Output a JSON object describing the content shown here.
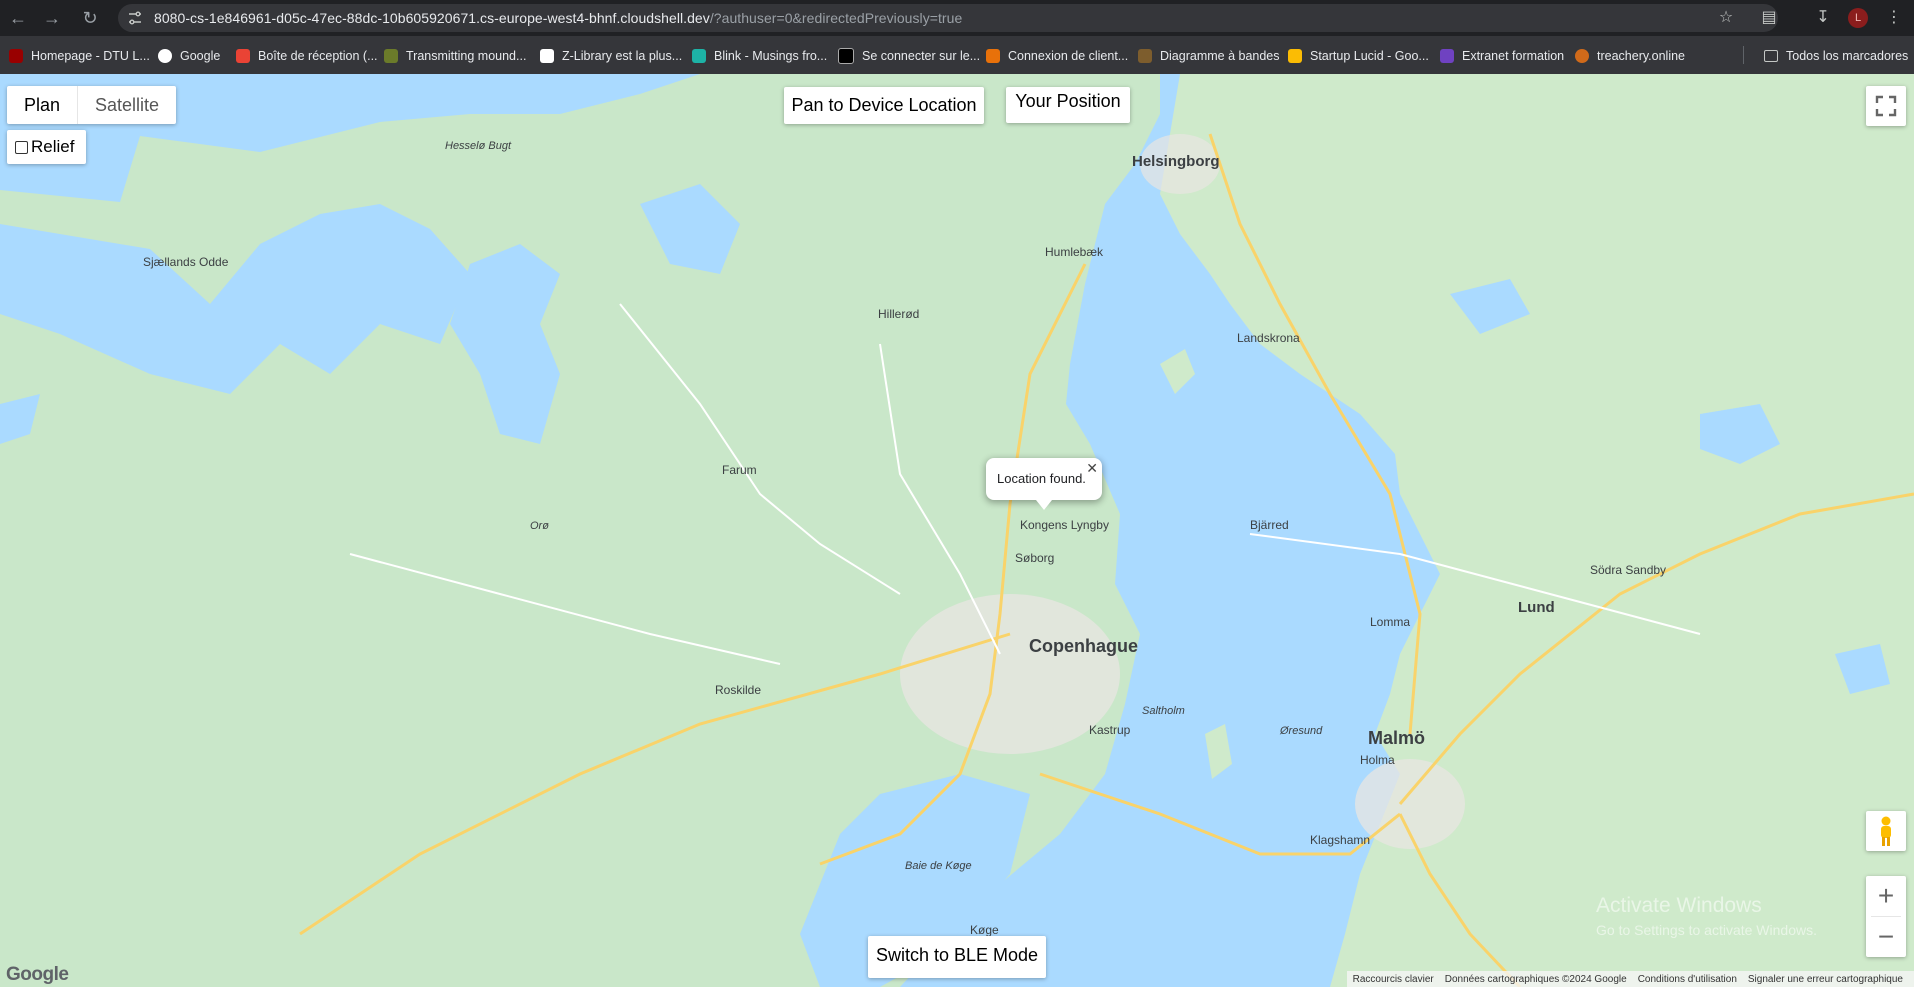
{
  "browser": {
    "url_main": "8080-cs-1e846961-d05c-47ec-88dc-10b605920671.cs-europe-west4-bhnf.cloudshell.dev",
    "url_query": "/?authuser=0&redirectedPreviously=true",
    "profile_initial": "L"
  },
  "bookmarks": {
    "items": [
      {
        "label": "Homepage - DTU L...",
        "color": "#990000"
      },
      {
        "label": "Google",
        "color": "#4285f4"
      },
      {
        "label": "Boîte de réception (...",
        "color": "#ea4335"
      },
      {
        "label": "Transmitting mound...",
        "color": "#6b7b2a"
      },
      {
        "label": "Z-Library est la plus...",
        "color": "#ffffff"
      },
      {
        "label": "Blink - Musings fro...",
        "color": "#1db3a6"
      },
      {
        "label": "Se connecter sur le...",
        "color": "#e8eaed"
      },
      {
        "label": "Connexion de client...",
        "color": "#e8710a"
      },
      {
        "label": "Diagramme à bandes",
        "color": "#7d5d2d"
      },
      {
        "label": "Startup Lucid - Goo...",
        "color": "#fbbc04"
      },
      {
        "label": "Extranet formation",
        "color": "#6f42c1"
      },
      {
        "label": "treachery.online",
        "color": "#d06a1a"
      }
    ],
    "all_bookmarks": "Todos los marcadores"
  },
  "map": {
    "type_plan": "Plan",
    "type_satellite": "Satellite",
    "relief_label": "Relief",
    "pan_button": "Pan to Device Location",
    "position_button": "Your Position",
    "ble_button": "Switch to BLE Mode",
    "info_window": "Location found.",
    "google_logo": "Google",
    "footer": [
      "Raccourcis clavier",
      "Données cartographiques ©2024 Google",
      "Conditions d'utilisation",
      "Signaler une erreur cartographique"
    ],
    "watermark_title": "Activate Windows",
    "watermark_sub": "Go to Settings to activate Windows."
  }
}
